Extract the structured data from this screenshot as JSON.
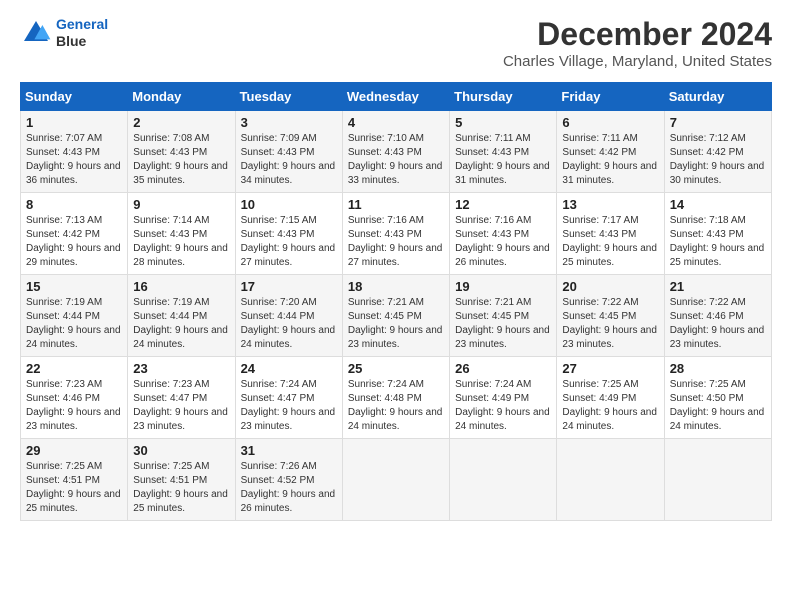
{
  "logo": {
    "line1": "General",
    "line2": "Blue"
  },
  "title": "December 2024",
  "subtitle": "Charles Village, Maryland, United States",
  "days_header": [
    "Sunday",
    "Monday",
    "Tuesday",
    "Wednesday",
    "Thursday",
    "Friday",
    "Saturday"
  ],
  "weeks": [
    [
      {
        "day": "1",
        "sunrise": "Sunrise: 7:07 AM",
        "sunset": "Sunset: 4:43 PM",
        "daylight": "Daylight: 9 hours and 36 minutes."
      },
      {
        "day": "2",
        "sunrise": "Sunrise: 7:08 AM",
        "sunset": "Sunset: 4:43 PM",
        "daylight": "Daylight: 9 hours and 35 minutes."
      },
      {
        "day": "3",
        "sunrise": "Sunrise: 7:09 AM",
        "sunset": "Sunset: 4:43 PM",
        "daylight": "Daylight: 9 hours and 34 minutes."
      },
      {
        "day": "4",
        "sunrise": "Sunrise: 7:10 AM",
        "sunset": "Sunset: 4:43 PM",
        "daylight": "Daylight: 9 hours and 33 minutes."
      },
      {
        "day": "5",
        "sunrise": "Sunrise: 7:11 AM",
        "sunset": "Sunset: 4:43 PM",
        "daylight": "Daylight: 9 hours and 31 minutes."
      },
      {
        "day": "6",
        "sunrise": "Sunrise: 7:11 AM",
        "sunset": "Sunset: 4:42 PM",
        "daylight": "Daylight: 9 hours and 31 minutes."
      },
      {
        "day": "7",
        "sunrise": "Sunrise: 7:12 AM",
        "sunset": "Sunset: 4:42 PM",
        "daylight": "Daylight: 9 hours and 30 minutes."
      }
    ],
    [
      {
        "day": "8",
        "sunrise": "Sunrise: 7:13 AM",
        "sunset": "Sunset: 4:42 PM",
        "daylight": "Daylight: 9 hours and 29 minutes."
      },
      {
        "day": "9",
        "sunrise": "Sunrise: 7:14 AM",
        "sunset": "Sunset: 4:43 PM",
        "daylight": "Daylight: 9 hours and 28 minutes."
      },
      {
        "day": "10",
        "sunrise": "Sunrise: 7:15 AM",
        "sunset": "Sunset: 4:43 PM",
        "daylight": "Daylight: 9 hours and 27 minutes."
      },
      {
        "day": "11",
        "sunrise": "Sunrise: 7:16 AM",
        "sunset": "Sunset: 4:43 PM",
        "daylight": "Daylight: 9 hours and 27 minutes."
      },
      {
        "day": "12",
        "sunrise": "Sunrise: 7:16 AM",
        "sunset": "Sunset: 4:43 PM",
        "daylight": "Daylight: 9 hours and 26 minutes."
      },
      {
        "day": "13",
        "sunrise": "Sunrise: 7:17 AM",
        "sunset": "Sunset: 4:43 PM",
        "daylight": "Daylight: 9 hours and 25 minutes."
      },
      {
        "day": "14",
        "sunrise": "Sunrise: 7:18 AM",
        "sunset": "Sunset: 4:43 PM",
        "daylight": "Daylight: 9 hours and 25 minutes."
      }
    ],
    [
      {
        "day": "15",
        "sunrise": "Sunrise: 7:19 AM",
        "sunset": "Sunset: 4:44 PM",
        "daylight": "Daylight: 9 hours and 24 minutes."
      },
      {
        "day": "16",
        "sunrise": "Sunrise: 7:19 AM",
        "sunset": "Sunset: 4:44 PM",
        "daylight": "Daylight: 9 hours and 24 minutes."
      },
      {
        "day": "17",
        "sunrise": "Sunrise: 7:20 AM",
        "sunset": "Sunset: 4:44 PM",
        "daylight": "Daylight: 9 hours and 24 minutes."
      },
      {
        "day": "18",
        "sunrise": "Sunrise: 7:21 AM",
        "sunset": "Sunset: 4:45 PM",
        "daylight": "Daylight: 9 hours and 23 minutes."
      },
      {
        "day": "19",
        "sunrise": "Sunrise: 7:21 AM",
        "sunset": "Sunset: 4:45 PM",
        "daylight": "Daylight: 9 hours and 23 minutes."
      },
      {
        "day": "20",
        "sunrise": "Sunrise: 7:22 AM",
        "sunset": "Sunset: 4:45 PM",
        "daylight": "Daylight: 9 hours and 23 minutes."
      },
      {
        "day": "21",
        "sunrise": "Sunrise: 7:22 AM",
        "sunset": "Sunset: 4:46 PM",
        "daylight": "Daylight: 9 hours and 23 minutes."
      }
    ],
    [
      {
        "day": "22",
        "sunrise": "Sunrise: 7:23 AM",
        "sunset": "Sunset: 4:46 PM",
        "daylight": "Daylight: 9 hours and 23 minutes."
      },
      {
        "day": "23",
        "sunrise": "Sunrise: 7:23 AM",
        "sunset": "Sunset: 4:47 PM",
        "daylight": "Daylight: 9 hours and 23 minutes."
      },
      {
        "day": "24",
        "sunrise": "Sunrise: 7:24 AM",
        "sunset": "Sunset: 4:47 PM",
        "daylight": "Daylight: 9 hours and 23 minutes."
      },
      {
        "day": "25",
        "sunrise": "Sunrise: 7:24 AM",
        "sunset": "Sunset: 4:48 PM",
        "daylight": "Daylight: 9 hours and 24 minutes."
      },
      {
        "day": "26",
        "sunrise": "Sunrise: 7:24 AM",
        "sunset": "Sunset: 4:49 PM",
        "daylight": "Daylight: 9 hours and 24 minutes."
      },
      {
        "day": "27",
        "sunrise": "Sunrise: 7:25 AM",
        "sunset": "Sunset: 4:49 PM",
        "daylight": "Daylight: 9 hours and 24 minutes."
      },
      {
        "day": "28",
        "sunrise": "Sunrise: 7:25 AM",
        "sunset": "Sunset: 4:50 PM",
        "daylight": "Daylight: 9 hours and 24 minutes."
      }
    ],
    [
      {
        "day": "29",
        "sunrise": "Sunrise: 7:25 AM",
        "sunset": "Sunset: 4:51 PM",
        "daylight": "Daylight: 9 hours and 25 minutes."
      },
      {
        "day": "30",
        "sunrise": "Sunrise: 7:25 AM",
        "sunset": "Sunset: 4:51 PM",
        "daylight": "Daylight: 9 hours and 25 minutes."
      },
      {
        "day": "31",
        "sunrise": "Sunrise: 7:26 AM",
        "sunset": "Sunset: 4:52 PM",
        "daylight": "Daylight: 9 hours and 26 minutes."
      },
      null,
      null,
      null,
      null
    ]
  ]
}
